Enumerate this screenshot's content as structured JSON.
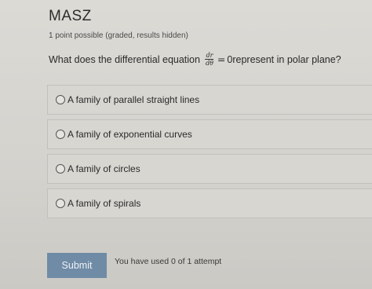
{
  "problem": {
    "title": "MASZ",
    "meta": "1 point possible (graded, results hidden)",
    "question": {
      "prefix": "What does the differential equation",
      "frac_num": "dr",
      "frac_den": "dθ",
      "equals": "=",
      "suffix": "0represent in polar plane?"
    },
    "options": [
      {
        "label": "A family of parallel straight lines",
        "selected": false
      },
      {
        "label": "A family of exponential curves",
        "selected": false
      },
      {
        "label": "A family of circles",
        "selected": false
      },
      {
        "label": "A family of spirals",
        "selected": false
      }
    ],
    "submit_label": "Submit",
    "attempts_text": "You have used 0 of 1 attempt"
  }
}
